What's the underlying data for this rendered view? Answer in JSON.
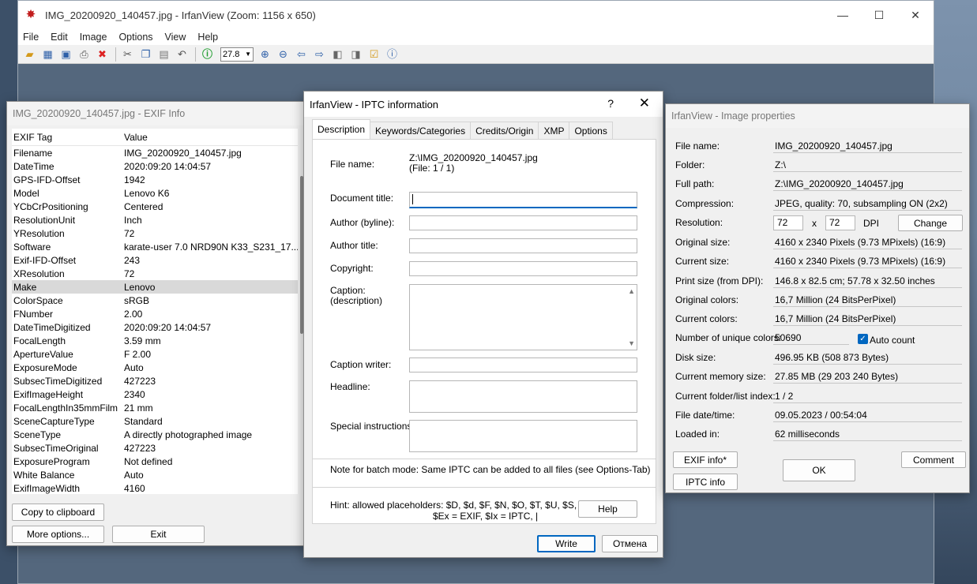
{
  "main_window": {
    "title": "IMG_20200920_140457.jpg - IrfanView (Zoom: 1156 x 650)",
    "menu": [
      "File",
      "Edit",
      "Image",
      "Options",
      "View",
      "Help"
    ],
    "zoom_value": "27.8",
    "controls": {
      "minimize": "—",
      "maximize": "☐",
      "close": "✕"
    }
  },
  "exif": {
    "title": "IMG_20200920_140457.jpg - EXIF Info",
    "col_tag": "EXIF Tag",
    "col_value": "Value",
    "rows": [
      {
        "tag": "Filename",
        "value": "IMG_20200920_140457.jpg"
      },
      {
        "tag": "DateTime",
        "value": "2020:09:20 14:04:57"
      },
      {
        "tag": "GPS-IFD-Offset",
        "value": "1942"
      },
      {
        "tag": "Model",
        "value": "Lenovo K6"
      },
      {
        "tag": "YCbCrPositioning",
        "value": "Centered"
      },
      {
        "tag": "ResolutionUnit",
        "value": "Inch"
      },
      {
        "tag": "YResolution",
        "value": "72"
      },
      {
        "tag": "Software",
        "value": "karate-user 7.0 NRD90N K33_S231_17..."
      },
      {
        "tag": "Exif-IFD-Offset",
        "value": "243"
      },
      {
        "tag": "XResolution",
        "value": "72"
      },
      {
        "tag": "Make",
        "value": "Lenovo"
      },
      {
        "tag": "ColorSpace",
        "value": "sRGB"
      },
      {
        "tag": "FNumber",
        "value": "2.00"
      },
      {
        "tag": "DateTimeDigitized",
        "value": "2020:09:20 14:04:57"
      },
      {
        "tag": "FocalLength",
        "value": "3.59 mm"
      },
      {
        "tag": "ApertureValue",
        "value": "F 2.00"
      },
      {
        "tag": "ExposureMode",
        "value": "Auto"
      },
      {
        "tag": "SubsecTimeDigitized",
        "value": "427223"
      },
      {
        "tag": "ExifImageHeight",
        "value": "2340"
      },
      {
        "tag": "FocalLengthIn35mmFilm",
        "value": "21 mm"
      },
      {
        "tag": "SceneCaptureType",
        "value": "Standard"
      },
      {
        "tag": "SceneType",
        "value": "A directly photographed image"
      },
      {
        "tag": "SubsecTimeOriginal",
        "value": "427223"
      },
      {
        "tag": "ExposureProgram",
        "value": "Not defined"
      },
      {
        "tag": "White Balance",
        "value": "Auto"
      },
      {
        "tag": "ExifImageWidth",
        "value": "4160"
      }
    ],
    "copy_button": "Copy to clipboard",
    "more_button": "More options...",
    "exit_button": "Exit"
  },
  "iptc": {
    "title": "IrfanView - IPTC information",
    "help_glyph": "?",
    "close_glyph": "✕",
    "tabs": [
      "Description",
      "Keywords/Categories",
      "Credits/Origin",
      "XMP",
      "Options"
    ],
    "file_name_label": "File name:",
    "file_name_value": "Z:\\IMG_20200920_140457.jpg",
    "file_index": "(File: 1 / 1)",
    "document_title_label": "Document title:",
    "author_label": "Author (byline):",
    "author_title_label": "Author title:",
    "copyright_label": "Copyright:",
    "caption_label": "Caption:",
    "caption_sub_label": "(description)",
    "caption_writer_label": "Caption writer:",
    "headline_label": "Headline:",
    "special_label": "Special instructions:",
    "batch_note": "Note for batch mode: Same IPTC can be added to all files (see Options-Tab)",
    "hint_line1": "Hint: allowed placeholders: $D, $d, $F, $N, $O, $T, $U, $S, $C,",
    "hint_line2": "$Ex = EXIF, $Ix = IPTC, |",
    "help_button": "Help",
    "write_button": "Write",
    "cancel_button": "Отмена"
  },
  "properties": {
    "title": "IrfanView - Image properties",
    "rows": [
      {
        "label": "File name:",
        "value": "IMG_20200920_140457.jpg"
      },
      {
        "label": "Folder:",
        "value": "Z:\\"
      },
      {
        "label": "Full path:",
        "value": "Z:\\IMG_20200920_140457.jpg"
      },
      {
        "label": "Compression:",
        "value": "JPEG, quality: 70, subsampling ON (2x2)"
      }
    ],
    "resolution_label": "Resolution:",
    "res_x": "72",
    "res_sep": "x",
    "res_y": "72",
    "res_unit": "DPI",
    "change_button": "Change",
    "rows2": [
      {
        "label": "Original size:",
        "value": "4160 x 2340  Pixels (9.73 MPixels) (16:9)"
      },
      {
        "label": "Current size:",
        "value": "4160 x 2340  Pixels (9.73 MPixels) (16:9)"
      },
      {
        "label": "Print size (from DPI):",
        "value": "146.8 x 82.5 cm; 57.78 x 32.50 inches"
      },
      {
        "label": "Original colors:",
        "value": "16,7 Million   (24 BitsPerPixel)"
      },
      {
        "label": "Current colors:",
        "value": "16,7 Million   (24 BitsPerPixel)"
      }
    ],
    "unique_label": "Number of unique colors:",
    "unique_value": "50690",
    "auto_count_label": "Auto count",
    "rows3": [
      {
        "label": "Disk size:",
        "value": "496.95 KB (508 873 Bytes)"
      },
      {
        "label": "Current memory size:",
        "value": "27.85  MB (29 203 240 Bytes)"
      },
      {
        "label": "Current folder/list index:",
        "value": " 1  /  2"
      },
      {
        "label": "File date/time:",
        "value": "09.05.2023 / 00:54:04"
      },
      {
        "label": "Loaded in:",
        "value": "62 milliseconds"
      }
    ],
    "exif_button": "EXIF info*",
    "iptc_button": "IPTC info",
    "ok_button": "OK",
    "comment_button": "Comment"
  }
}
